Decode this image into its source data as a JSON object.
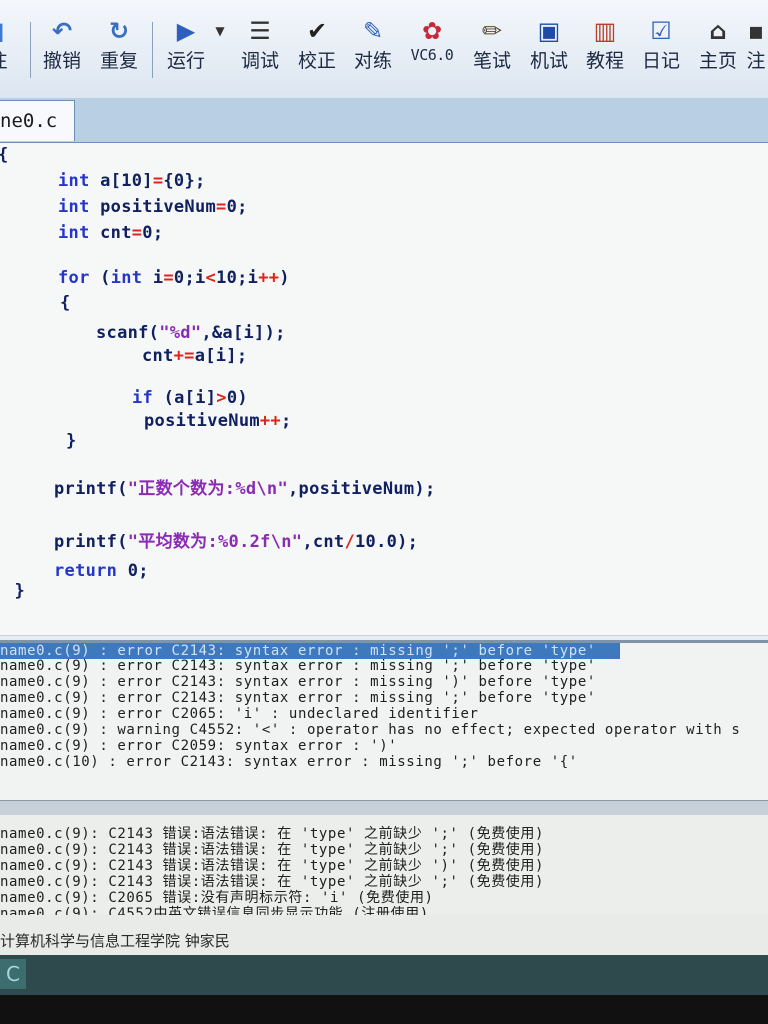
{
  "toolbar": {
    "buttons": [
      {
        "label": "注",
        "icon": "note-icon"
      },
      {
        "label": "撤销",
        "icon": "undo-icon"
      },
      {
        "label": "重复",
        "icon": "redo-icon"
      },
      {
        "label": "运行",
        "icon": "run-icon"
      },
      {
        "label": "调试",
        "icon": "debug-icon"
      },
      {
        "label": "校正",
        "icon": "check-icon"
      },
      {
        "label": "对练",
        "icon": "practice-icon"
      },
      {
        "label": "VC6.0",
        "icon": "vc6-icon"
      },
      {
        "label": "笔试",
        "icon": "pen-icon"
      },
      {
        "label": "机试",
        "icon": "computer-test-icon"
      },
      {
        "label": "教程",
        "icon": "books-icon"
      },
      {
        "label": "日记",
        "icon": "diary-icon"
      },
      {
        "label": "主页",
        "icon": "home-icon"
      },
      {
        "label": "注",
        "icon": "register-icon"
      }
    ]
  },
  "tab": {
    "label": "ne0.c"
  },
  "code": [
    "{",
    "    int a[10]={0};",
    "    int positiveNum=0;",
    "    int cnt=0;",
    "",
    "    for (int i=0;i<10;i++)",
    "    {",
    "       scanf(\"%d\",&a[i]);",
    "           cnt+=a[i];",
    "",
    "          if (a[i]>0)",
    "           positiveNum++;",
    "    }",
    "",
    "   printf(\"正数个数为:%d\\n\",positiveNum);",
    "",
    "   printf(\"平均数为:%0.2f\\n\",cnt/10.0);",
    "",
    "   return 0;",
    " }"
  ],
  "errors": [
    "name0.c(9) : error C2143: syntax error : missing ';' before 'type'",
    "name0.c(9) : error C2143: syntax error : missing ';' before 'type'",
    "name0.c(9) : error C2143: syntax error : missing ')' before 'type'",
    "name0.c(9) : error C2143: syntax error : missing ';' before 'type'",
    "name0.c(9) : error C2065: 'i' : undeclared identifier",
    "name0.c(9) : warning C4552: '<' : operator has no effect; expected operator with s",
    "name0.c(9) : error C2059: syntax error : ')'",
    "name0.c(10) : error C2143: syntax error : missing ';' before '{'"
  ],
  "hints": [
    "name0.c(9): C2143 错误:语法错误: 在 'type' 之前缺少 ';' (免费使用)",
    "name0.c(9): C2143 错误:语法错误: 在 'type' 之前缺少 ';' (免费使用)",
    "name0.c(9): C2143 错误:语法错误: 在 'type' 之前缺少 ')' (免费使用)",
    "name0.c(9): C2143 错误:语法错误: 在 'type' 之前缺少 ';' (免费使用)",
    "name0.c(9): C2065 错误:没有声明标示符: 'i' (免费使用)",
    "name0.c(9): C4552中英文错误信息同步显示功能 (注册使用)"
  ],
  "status": {
    "text": "计算机科学与信息工程学院   钟家民"
  },
  "taskbar": {
    "icon_label": "C"
  },
  "colors": {
    "keyword": "#2636c9",
    "operator": "#e0241d",
    "string": "#8a2bb3",
    "selection": "#3e78bd"
  }
}
